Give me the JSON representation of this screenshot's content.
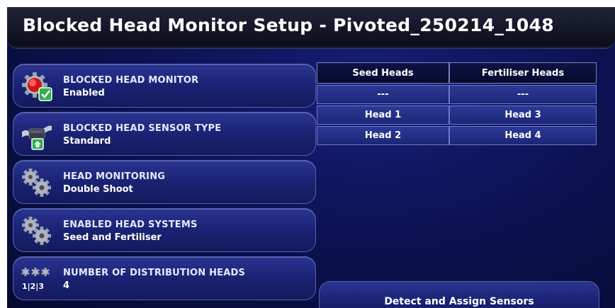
{
  "header": {
    "title": "Blocked Head Monitor Setup - Pivoted_250214_1048"
  },
  "settings": [
    {
      "label": "BLOCKED HEAD MONITOR",
      "value": "Enabled",
      "icon": "blocked-head-monitor-icon"
    },
    {
      "label": "BLOCKED HEAD SENSOR TYPE",
      "value": "Standard",
      "icon": "sensor-type-icon"
    },
    {
      "label": "HEAD MONITORING",
      "value": "Double Shoot",
      "icon": "gears-icon"
    },
    {
      "label": "ENABLED HEAD SYSTEMS",
      "value": "Seed and Fertiliser",
      "icon": "gears-icon"
    },
    {
      "label": "NUMBER OF DISTRIBUTION HEADS",
      "value": "4",
      "icon": "distribution-heads-icon",
      "icon_text": "1|2|3"
    }
  ],
  "head_table": {
    "columns": [
      "Seed Heads",
      "Fertiliser Heads"
    ],
    "rows": [
      [
        "---",
        "---"
      ],
      [
        "Head 1",
        "Head 3"
      ],
      [
        "Head 2",
        "Head 4"
      ]
    ]
  },
  "actions": {
    "detect_label": "Detect and Assign Sensors"
  },
  "colors": {
    "background": "#0c1252",
    "button": "#1a2374",
    "check_green": "#2db34a",
    "sensor_red": "#d01818"
  }
}
